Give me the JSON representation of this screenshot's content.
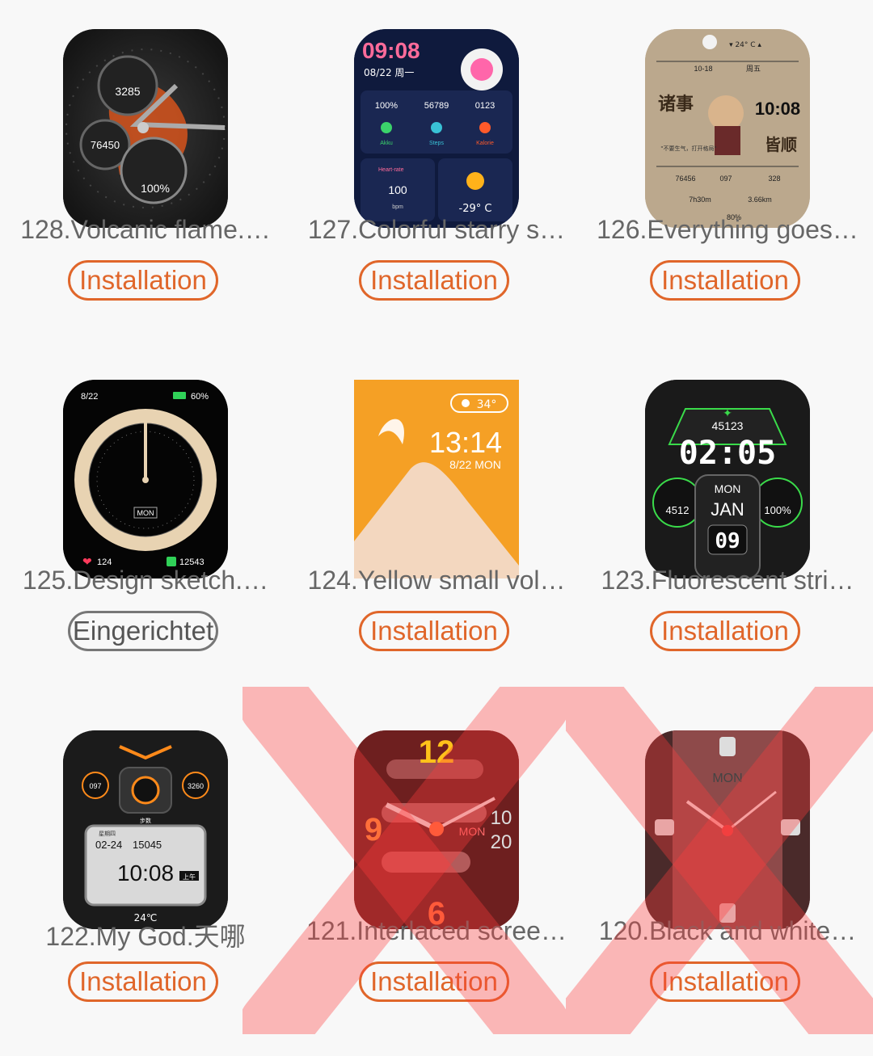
{
  "faces": [
    {
      "title": "128.Volcanic flame.…",
      "button": "Installation",
      "installed": false,
      "texts": {
        "steps": "3285",
        "kcal": "76450",
        "battery": "100%"
      }
    },
    {
      "title": "127.Colorful starry s…",
      "button": "Installation",
      "installed": false,
      "texts": {
        "time": "09:08",
        "date": "08/22 周一",
        "battery": "100%",
        "steps": "56789",
        "kcal": "0123",
        "l1": "Akku",
        "l2": "Steps",
        "l3": "Kalorie",
        "hr_label": "Heart-rate",
        "hr": "100",
        "hr_unit": "bpm",
        "temp": "-29° C"
      }
    },
    {
      "title": "126.Everything goes…",
      "button": "Installation",
      "installed": false,
      "texts": {
        "weather": "▾ 24° C ▴",
        "date": "10-18",
        "day": "周五",
        "big1": "诸事",
        "big2": "皆顺",
        "time": "10:08",
        "motto": "\"不要生气，打开格局\"",
        "steps": "76456",
        "hr": "097",
        "kcal": "328",
        "sleep": "7h30m",
        "dist": "3.66km",
        "battery": "80%"
      }
    },
    {
      "title": "125.Design sketch.…",
      "button": "Eingerichtet",
      "installed": true,
      "texts": {
        "date": "8/22",
        "battery": "60%",
        "day": "MON",
        "hr": "124",
        "steps": "12543"
      }
    },
    {
      "title": "124.Yellow small vol…",
      "button": "Installation",
      "installed": false,
      "texts": {
        "temp": "34°",
        "time": "13:14",
        "date": "8/22 MON"
      }
    },
    {
      "title": "123.Fluorescent stri…",
      "button": "Installation",
      "installed": false,
      "texts": {
        "steps": "45123",
        "time": "02:05",
        "kcal": "4512",
        "day": "MON",
        "month": "JAN",
        "battery": "100%",
        "date": "09"
      }
    },
    {
      "title": "122.My God.天哪",
      "button": "Installation",
      "installed": false,
      "texts": {
        "hr": "097",
        "kcal": "3260",
        "label": "步数",
        "date": "02-24",
        "steps": "15045",
        "day": "星期四",
        "time": "10:08",
        "ampm": "上午",
        "temp": "24℃"
      }
    },
    {
      "title": "121.Interlaced scree…",
      "button": "Installation",
      "installed": false,
      "texts": {
        "n12": "12",
        "n9": "9",
        "n6": "6",
        "day": "MON",
        "n10": "10",
        "n20": "20"
      }
    },
    {
      "title": "120.Black and white…",
      "button": "Installation",
      "installed": false,
      "texts": {
        "day": "MON"
      }
    }
  ],
  "colors": {
    "accent": "#e0662a",
    "installed": "#777777",
    "title": "#666666"
  }
}
